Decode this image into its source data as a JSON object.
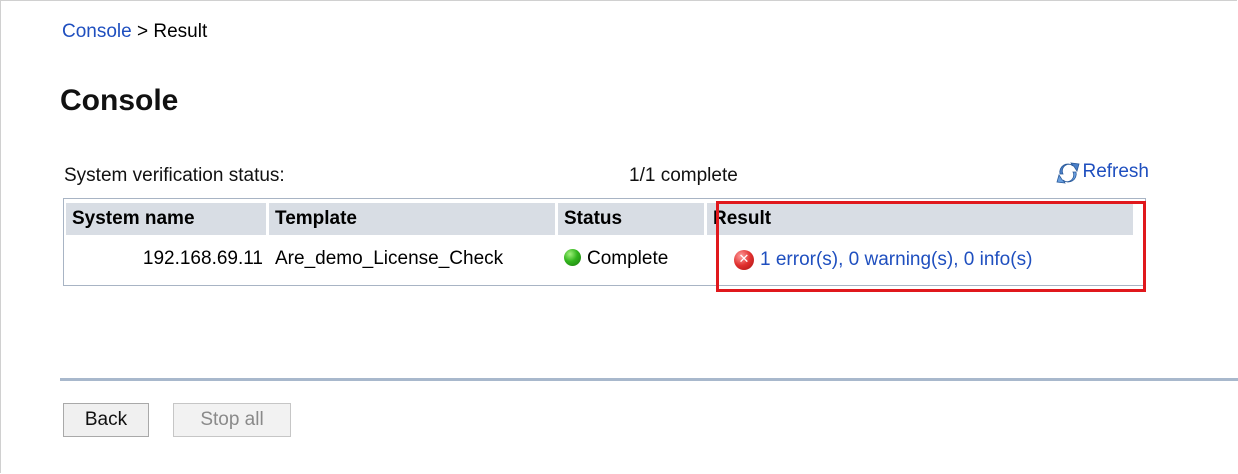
{
  "breadcrumb": {
    "link": "Console",
    "separator": ">",
    "current": "Result"
  },
  "page_title": "Console",
  "status": {
    "label": "System verification status:",
    "count": "1/1 complete",
    "refresh_label": "Refresh"
  },
  "table": {
    "headers": [
      "System name",
      "Template",
      "Status",
      "Result"
    ],
    "rows": [
      {
        "system_name": "192.168.69.11",
        "template": "Are_demo_License_Check",
        "status": "Complete",
        "result": "1 error(s), 0 warning(s), 0 info(s)",
        "result_icon": "error-icon"
      }
    ]
  },
  "buttons": {
    "back": "Back",
    "stop_all": "Stop all"
  },
  "colors": {
    "link": "#1f4fbf",
    "header_bg": "#d8dde4",
    "highlight": "#e0181c",
    "status_ok": "#33b51e",
    "error": "#e0302e"
  }
}
